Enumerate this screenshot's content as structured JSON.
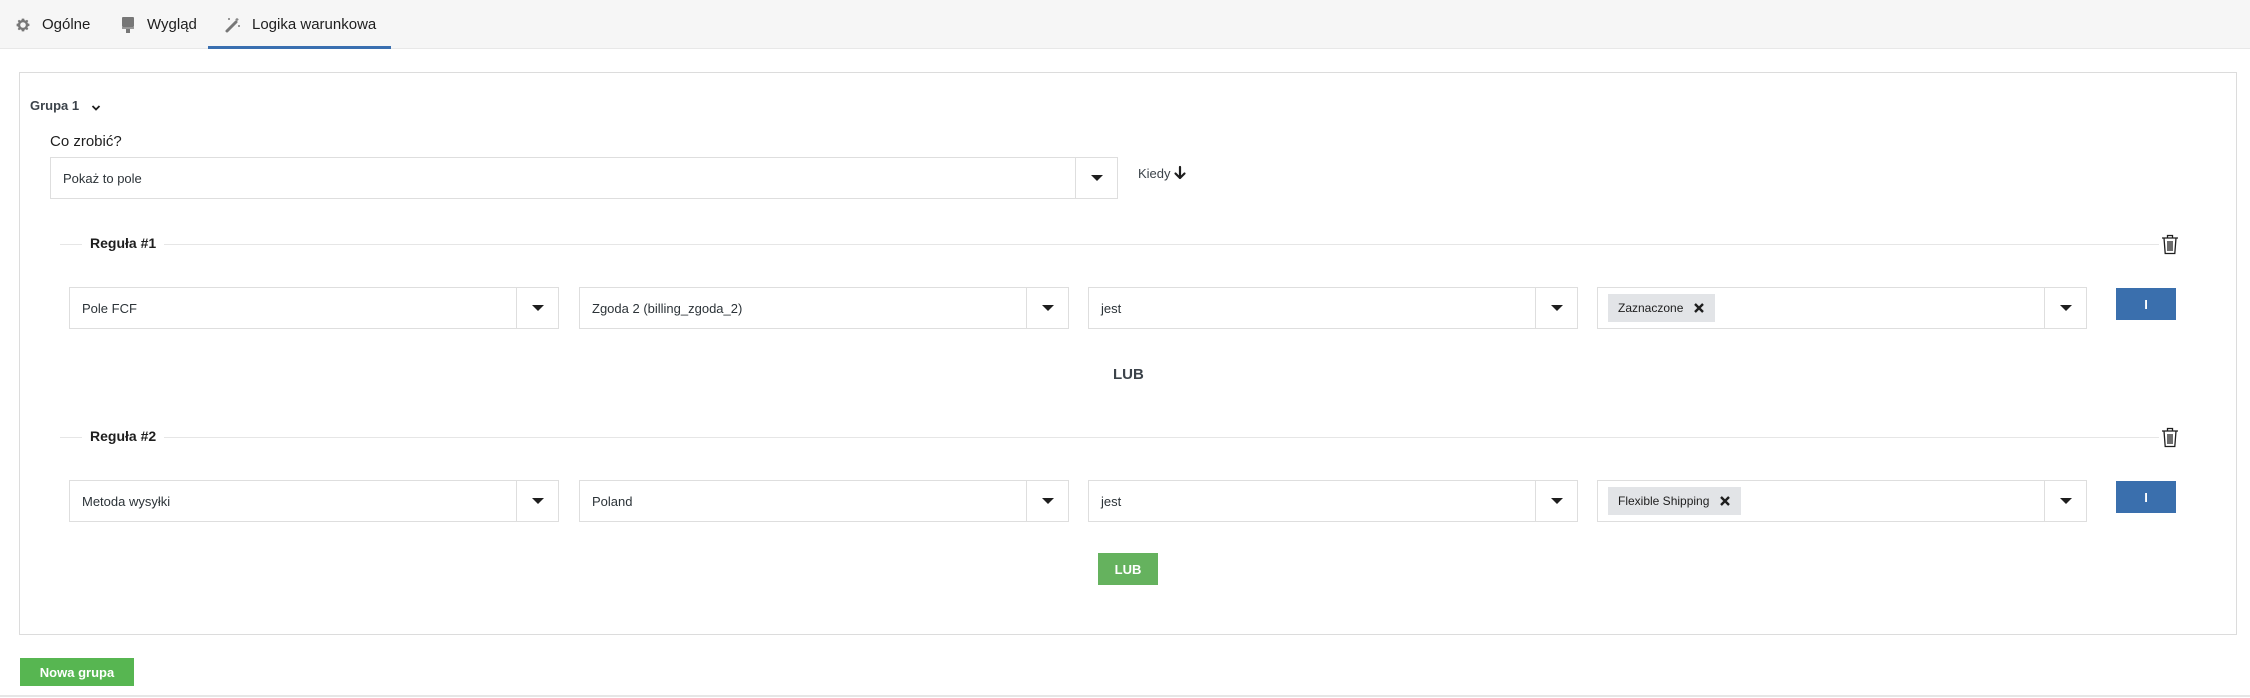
{
  "tabs": [
    {
      "label": "Ogólne",
      "icon": "gear-icon",
      "active": false
    },
    {
      "label": "Wygląd",
      "icon": "paint-brush-icon",
      "active": false
    },
    {
      "label": "Logika warunkowa",
      "icon": "magic-wand-icon",
      "active": true
    }
  ],
  "group": {
    "title": "Grupa 1",
    "what_label": "Co zrobić?",
    "action_value": "Pokaż to pole",
    "when_label": "Kiedy"
  },
  "rules": [
    {
      "title": "Reguła #1",
      "field_type": "Pole FCF",
      "field": "Zgoda 2 (billing_zgoda_2)",
      "operator": "jest",
      "values": [
        "Zaznaczone"
      ],
      "and_label": "I"
    },
    {
      "title": "Reguła #2",
      "field_type": "Metoda wysyłki",
      "field": "Poland",
      "operator": "jest",
      "values": [
        "Flexible Shipping"
      ],
      "and_label": "I"
    }
  ],
  "or_separator": "LUB",
  "or_button": "LUB",
  "new_group_button": "Nowa grupa",
  "colors": {
    "tab_active": "#3a6fb0",
    "and_button": "#3a6fad",
    "or_button": "#65b25e",
    "new_group_button": "#57b651"
  }
}
